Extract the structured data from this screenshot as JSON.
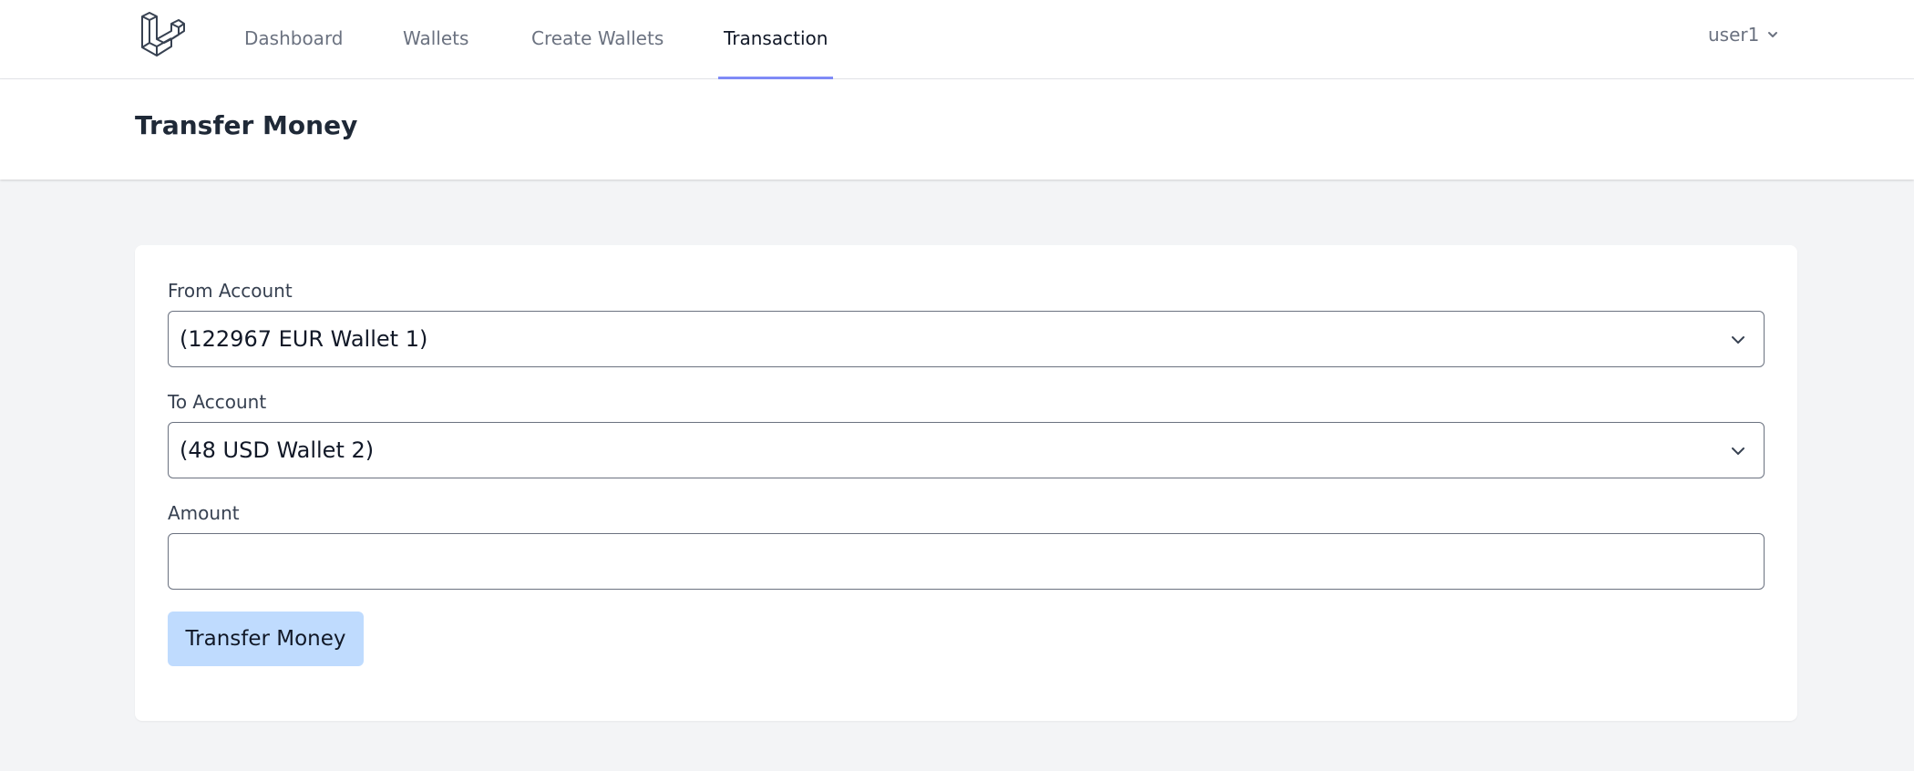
{
  "nav": {
    "logo_icon": "laravel-logo-icon",
    "links": [
      {
        "label": "Dashboard",
        "active": false
      },
      {
        "label": "Wallets",
        "active": false
      },
      {
        "label": "Create Wallets",
        "active": false
      },
      {
        "label": "Transaction",
        "active": true
      }
    ],
    "user": {
      "name": "user1",
      "icon": "chevron-down-icon"
    },
    "active_underline_color": "#818cf8"
  },
  "header": {
    "title": "Transfer Money"
  },
  "form": {
    "from_account": {
      "label": "From Account",
      "selected": "(122967 EUR Wallet 1)"
    },
    "to_account": {
      "label": "To Account",
      "selected": "(48 USD Wallet 2)"
    },
    "amount": {
      "label": "Amount",
      "value": "",
      "placeholder": ""
    },
    "submit_label": "Transfer Money",
    "submit_color": "#bfdbfe"
  }
}
